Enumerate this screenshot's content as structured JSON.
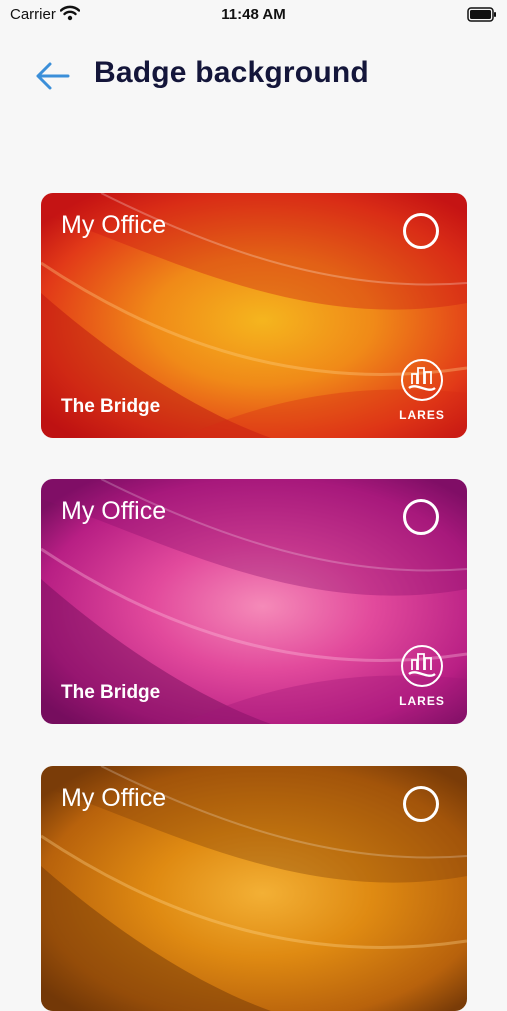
{
  "status_bar": {
    "carrier": "Carrier",
    "time": "11:48 AM"
  },
  "header": {
    "title": "Badge background"
  },
  "cards": [
    {
      "title": "My Office",
      "subtitle": "The Bridge",
      "logo_text": "LARES",
      "theme": "red-orange",
      "colors": [
        "#f5b51e",
        "#f08a18",
        "#e23a18",
        "#c41414"
      ]
    },
    {
      "title": "My Office",
      "subtitle": "The Bridge",
      "logo_text": "LARES",
      "theme": "pink-purple",
      "colors": [
        "#f58ab8",
        "#e24a9c",
        "#b81f84",
        "#7c0f63"
      ]
    },
    {
      "title": "My Office",
      "subtitle": "",
      "logo_text": "",
      "theme": "orange-brown",
      "colors": [
        "#f3b035",
        "#df8a12",
        "#b8620c",
        "#7a3c08"
      ]
    }
  ]
}
